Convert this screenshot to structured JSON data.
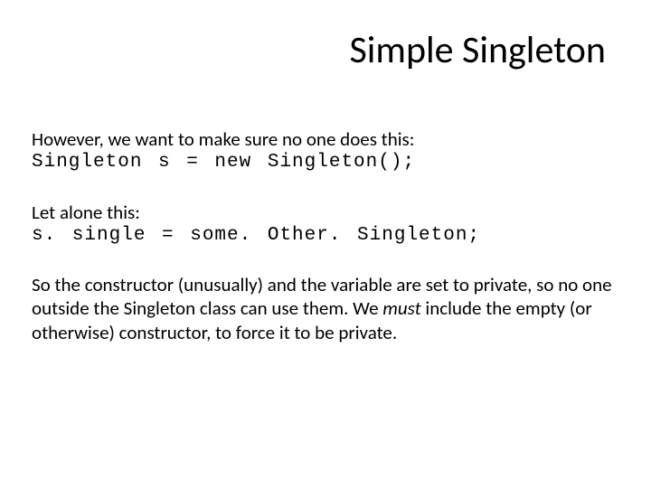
{
  "title": "Simple Singleton",
  "p1_line1": "However, we want to make sure no one does this:",
  "p1_code": "Singleton s = new Singleton();",
  "p2_line1": "Let alone this:",
  "p2_code": "s. single = some. Other. Singleton;",
  "p3_a": "So the constructor (unusually) and the variable are set to private, so no one outside the Singleton class can use them. We ",
  "p3_b": "must",
  "p3_c": " include the empty (or otherwise) constructor, to force it to be private."
}
